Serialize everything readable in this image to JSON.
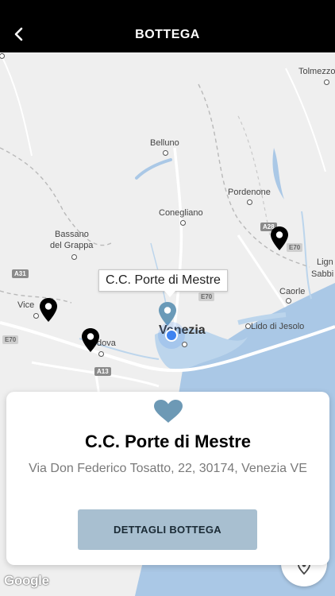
{
  "header": {
    "title": "BOTTEGA",
    "back_icon": "chevron-left-icon"
  },
  "map": {
    "places": {
      "tolmezzo": "Tolmezzo",
      "belluno": "Belluno",
      "pordenone": "Pordenone",
      "conegliano": "Conegliano",
      "bassano_line1": "Bassano",
      "bassano_line2": "del Grappa",
      "lignano": "Lign",
      "sabbia": "Sabbi",
      "caorle": "Caorle",
      "vicenza": "Vice",
      "lido": "Lido di Jesolo",
      "padova": "dova",
      "venezia": "Venezia"
    },
    "roads": {
      "a31": "A31",
      "e70_w": "E70",
      "a13": "A13",
      "e70_c": "E70",
      "a28": "A28",
      "e70_e": "E70"
    },
    "callout": "C.C. Porte di Mestre",
    "attribution": "Google",
    "marker_color": "#000000",
    "selected_marker_color": "#6a9ab8"
  },
  "card": {
    "title": "C.C. Porte di Mestre",
    "address": "Via Don Federico Tosatto, 22, 30174, Venezia VE",
    "button_label": "DETTAGLI BOTTEGA",
    "heart_icon": "heart-icon",
    "heart_color": "#6d99b5",
    "button_color": "#a8bfd0"
  },
  "locate_icon": "location-icon"
}
